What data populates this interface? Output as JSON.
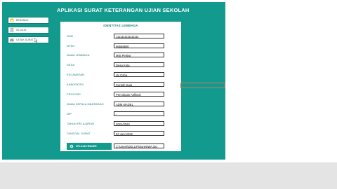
{
  "app": {
    "title": "APLIKASI SURAT KETERANGAN UJIAN SEKOLAH"
  },
  "sidebar": {
    "items": [
      {
        "label": "BERANDA",
        "icon": "home-icon"
      },
      {
        "label": "ISI DATA",
        "icon": "document-icon"
      },
      {
        "label": "CETAK SURAT",
        "icon": "print-icon"
      }
    ]
  },
  "form": {
    "title": "IDENTITAS LEMBAGA",
    "fields": [
      {
        "label": "NSM",
        "value": "1111111111111111"
      },
      {
        "label": "NPSN",
        "value": "66558800"
      },
      {
        "label": "NAMA LEMBAGA",
        "value": "MIS Pertiwi"
      },
      {
        "label": "DESA",
        "value": "Desa Kota"
      },
      {
        "label": "KECAMATAN",
        "value": "Uji Coba"
      },
      {
        "label": "KABUPATEN",
        "value": "Contoh Saja"
      },
      {
        "label": "PROVINSI",
        "value": "Percobaan Aplikasi"
      },
      {
        "label": "NAMA KEPALA MADRASAH",
        "value": "ADM MADEL"
      },
      {
        "label": "NIP",
        "value": "-"
      },
      {
        "label": "TAHUN PELAJARAN",
        "value": "2021/2022"
      },
      {
        "label": "TANGGAL SURAT",
        "value": "04 Juni 2022"
      }
    ],
    "upload": {
      "label": "UPLOAD HEADER",
      "path": "C:\\Users\\DELL\\Pictures\\WA.jpg"
    }
  },
  "colors": {
    "primary": "#139a8e",
    "panel": "#ffffff",
    "label": "#0b7a6f",
    "selection": "#c87a5a"
  }
}
